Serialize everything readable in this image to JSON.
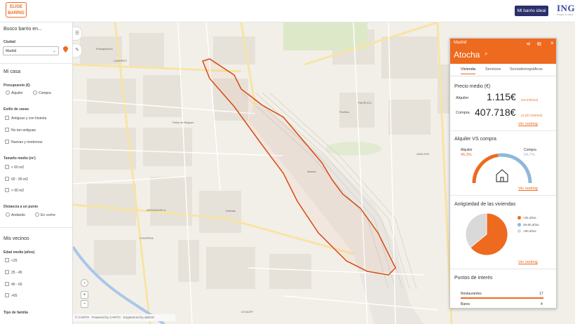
{
  "header": {
    "logo_text": "ELIGE BARRIO",
    "mibarrio_label": "Mi barrio ideal",
    "brand": "ING",
    "brand_sub": "People in mind"
  },
  "sidebar": {
    "title": "Busco barrio en...",
    "ciudad_label": "Ciudad",
    "ciudad_value": "Madrid",
    "mi_casa": "Mi casa",
    "presupuesto_label": "Presupuesto (€)",
    "presupuesto_options": [
      "Alquiler",
      "Compra"
    ],
    "estilo_label": "Estilo de casas",
    "estilo_options": [
      "Antiguas y con historia",
      "No tan antiguas",
      "Nuevas y modernas"
    ],
    "tamano_label": "Tamaño medio (m²)",
    "tamano_options": [
      "< 60 m2",
      "60 - 90 m2",
      "> 90 m2"
    ],
    "distancia_label": "Distancia a un punto",
    "distancia_options": [
      "Andando",
      "En coche"
    ],
    "mis_vecinos": "Mis vecinos",
    "edad_label": "Edad media (años)",
    "edad_options": [
      "<25",
      "25 - 45",
      "45 - 65",
      ">65"
    ],
    "familia_label": "Tipo de familia"
  },
  "map": {
    "labels": {
      "embajadores": "Embajadores",
      "lavapies": "LAVAPIÉS",
      "palos": "Palos de Moguer",
      "pacifico": "PACÍFICO",
      "pacifico2": "Pacífico",
      "atocha": "Atocha",
      "arganzuela": "ARGANZUELA",
      "delicias": "Delicias",
      "adelfas": "ADELFAS",
      "chopera": "CHOPERA",
      "legazpi": "LEGAZPI"
    },
    "attribution": "© CARTO · Powered by CARTO · Engineered by datGIS"
  },
  "panel": {
    "city": "Madrid",
    "barrio": "Atocha",
    "tabs": [
      "Vivienda",
      "Servicios",
      "Sociodemográficos"
    ],
    "precio_title": "Precio medio (€)",
    "alquiler_label": "Alquiler",
    "alquiler_value": "1.115€",
    "alquiler_unit": "(15,07€/m2)",
    "compra_label": "Compra",
    "compra_value": "407.718€",
    "compra_unit": "(4.227,31€/m2)",
    "ver_ranking": "Ver ranking",
    "vs_title": "Alquiler VS compra",
    "vs_alquiler_label": "Alquiler",
    "vs_alquiler_pct": "45,3%",
    "vs_compra_label": "Compra",
    "vs_compra_pct": "54,7%",
    "antig_title": "Antigüedad de las viviendas",
    "antig_legend": [
      "<25 años",
      "25-50 años",
      ">50 años"
    ],
    "interes_title": "Puntos de interés",
    "interes_items": [
      {
        "label": "Restaurantes",
        "count": "17",
        "fill": 1.0
      },
      {
        "label": "Bares",
        "count": "4",
        "fill": 0.24
      }
    ],
    "colors": {
      "orange": "#ee6a1f",
      "blue": "#8fb7d9",
      "grey": "#d9d9d9"
    }
  },
  "chart_data": [
    {
      "type": "pie",
      "title": "Alquiler VS compra",
      "categories": [
        "Alquiler",
        "Compra"
      ],
      "values": [
        45.3,
        54.7
      ]
    },
    {
      "type": "pie",
      "title": "Antigüedad de las viviendas",
      "categories": [
        "<25 años",
        "25-50 años",
        ">50 años"
      ],
      "values": [
        64,
        0,
        36
      ]
    }
  ]
}
